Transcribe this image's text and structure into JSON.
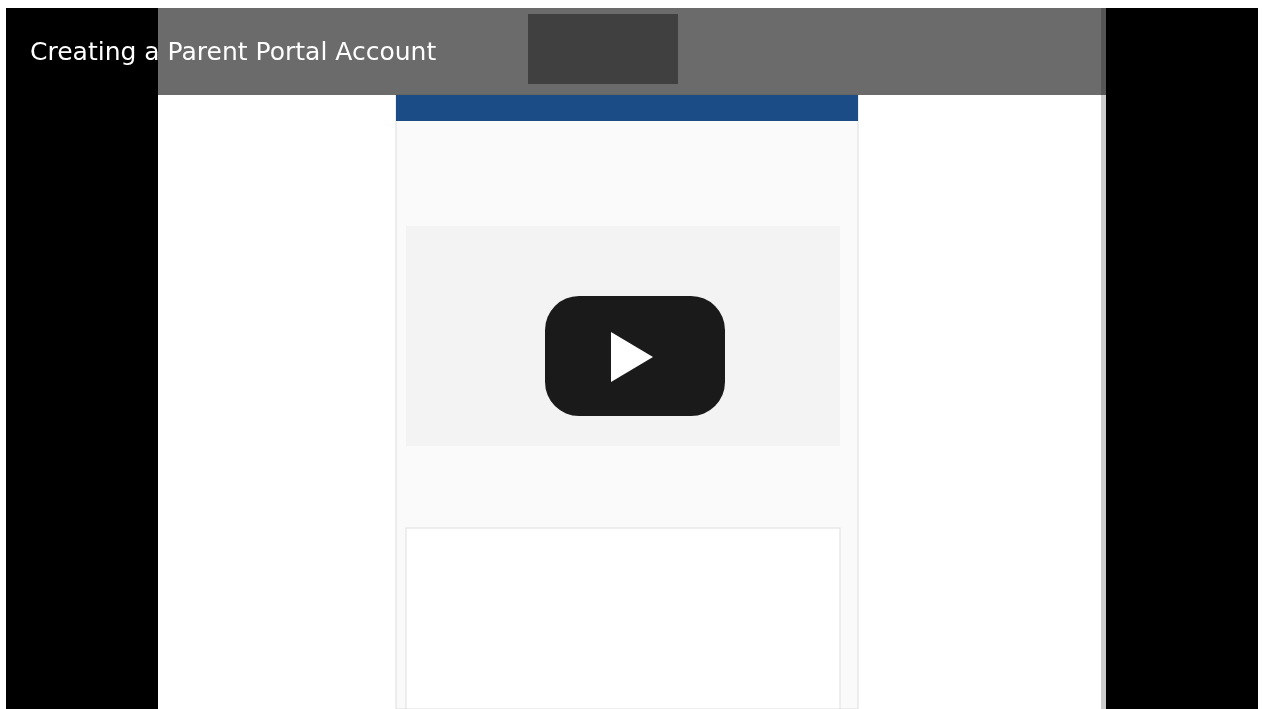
{
  "video": {
    "title": "Creating a Parent Portal Account"
  }
}
